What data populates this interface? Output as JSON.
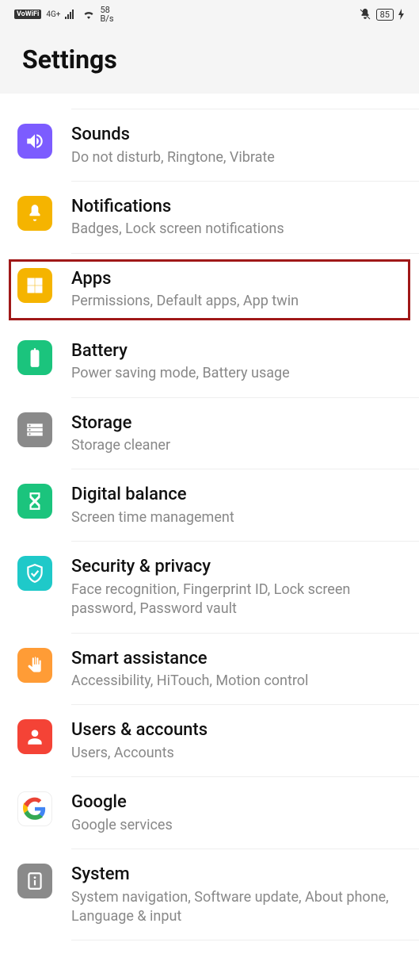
{
  "status": {
    "vowifi": "VoWiFi",
    "net": "4G+",
    "speed_top": "58",
    "speed_bottom": "B/s",
    "battery": "85"
  },
  "header": {
    "title": "Settings"
  },
  "items": [
    {
      "title": "Sounds",
      "subtitle": "Do not disturb, Ringtone, Vibrate"
    },
    {
      "title": "Notifications",
      "subtitle": "Badges, Lock screen notifications"
    },
    {
      "title": "Apps",
      "subtitle": "Permissions, Default apps, App twin"
    },
    {
      "title": "Battery",
      "subtitle": "Power saving mode, Battery usage"
    },
    {
      "title": "Storage",
      "subtitle": "Storage cleaner"
    },
    {
      "title": "Digital balance",
      "subtitle": "Screen time management"
    },
    {
      "title": "Security & privacy",
      "subtitle": "Face recognition, Fingerprint ID, Lock screen password, Password vault"
    },
    {
      "title": "Smart assistance",
      "subtitle": "Accessibility, HiTouch, Motion control"
    },
    {
      "title": "Users & accounts",
      "subtitle": "Users, Accounts"
    },
    {
      "title": "Google",
      "subtitle": "Google services"
    },
    {
      "title": "System",
      "subtitle": "System navigation, Software update, About phone, Language & input"
    }
  ]
}
